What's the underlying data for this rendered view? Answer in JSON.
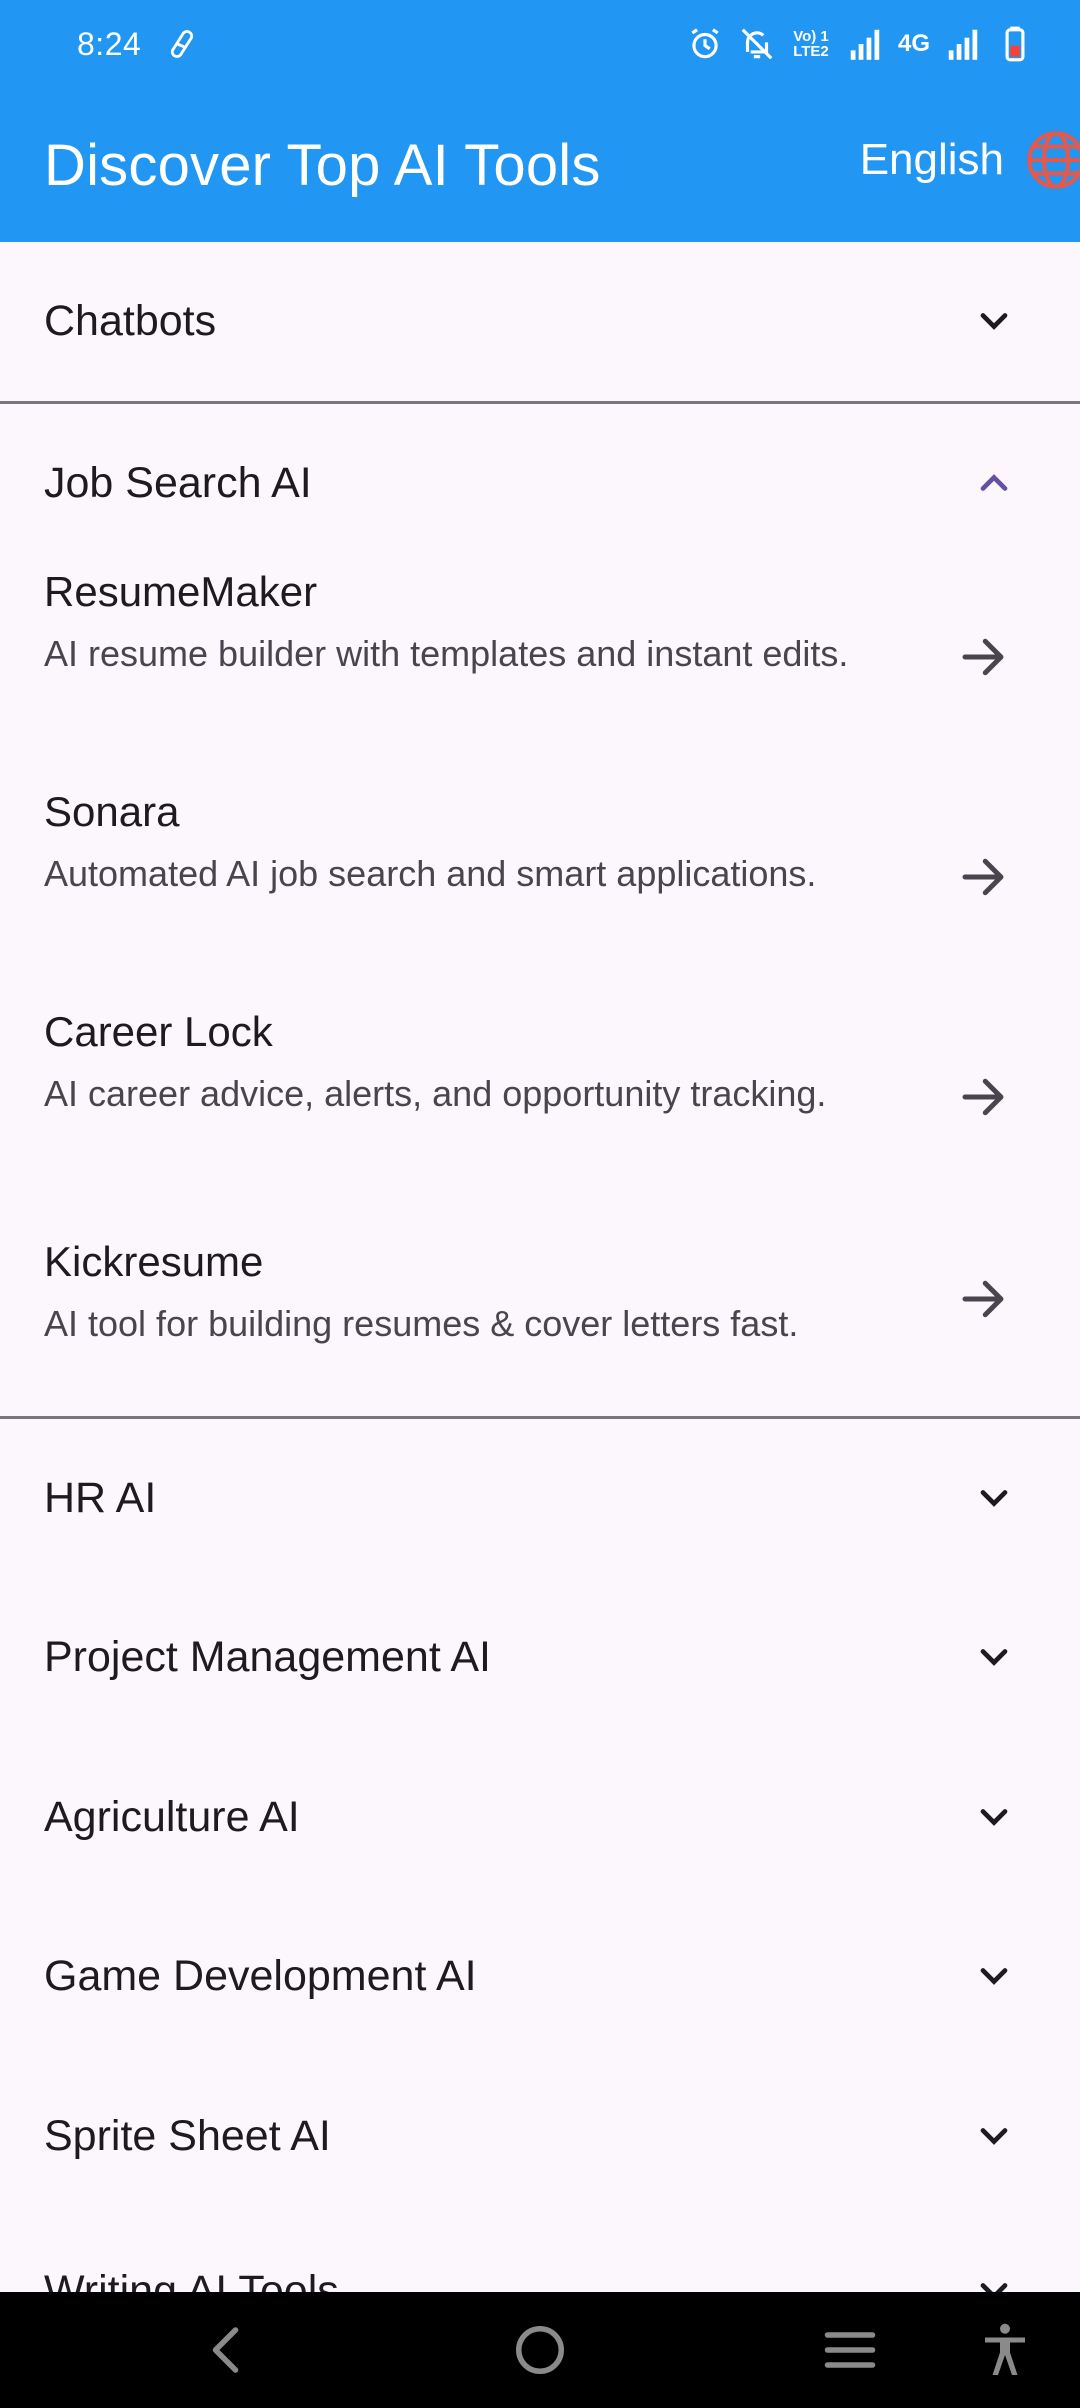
{
  "status_bar": {
    "time": "8:24",
    "network_label": "4G",
    "volte_top": "Vo) 1",
    "volte_bottom": "LTE2",
    "icons": [
      "sync-icon",
      "alarm-icon",
      "bell-off-icon",
      "volte-icon",
      "signal-icon",
      "signal-icon",
      "battery-low-icon"
    ]
  },
  "app_bar": {
    "title": "Discover Top AI Tools",
    "language": "English",
    "globe_color": "#e05a4f",
    "bar_color": "#2196f3"
  },
  "sections": [
    {
      "title": "Chatbots",
      "expanded": false
    },
    {
      "title": "Job Search AI",
      "expanded": true,
      "tools": [
        {
          "name": "ResumeMaker",
          "desc": "AI resume builder with templates and instant edits."
        },
        {
          "name": "Sonara",
          "desc": "Automated AI job search and smart applications."
        },
        {
          "name": "Career Lock",
          "desc": "AI career advice, alerts, and opportunity tracking."
        },
        {
          "name": "Kickresume",
          "desc": "AI tool for building resumes & cover letters fast."
        }
      ]
    },
    {
      "title": "HR AI",
      "expanded": false
    },
    {
      "title": "Project Management AI",
      "expanded": false
    },
    {
      "title": "Agriculture AI",
      "expanded": false
    },
    {
      "title": "Game Development AI",
      "expanded": false
    },
    {
      "title": "Sprite Sheet AI",
      "expanded": false
    },
    {
      "title": "Writing AI Tools",
      "expanded": false
    }
  ],
  "colors": {
    "accent": "#6750a4",
    "background": "#fcf7fc"
  },
  "nav_bar": {
    "icons": [
      "back-icon",
      "home-icon",
      "recents-icon",
      "accessibility-icon"
    ]
  }
}
